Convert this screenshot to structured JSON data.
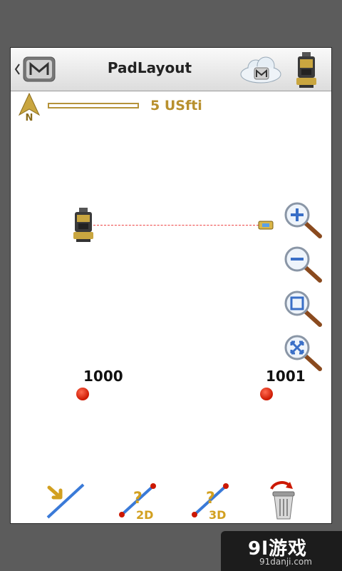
{
  "header": {
    "title": "PadLayout",
    "back_icon": "m-logo-back-icon",
    "cloud_icon": "cloud-sync-icon",
    "device_icon": "total-station-icon"
  },
  "map": {
    "north_label": "N",
    "scale_text": "5 USfti",
    "points": [
      {
        "label": "1000"
      },
      {
        "label": "1001"
      }
    ]
  },
  "zoom_controls": [
    "zoom-in-icon",
    "zoom-out-icon",
    "zoom-extents-icon",
    "zoom-fit-icon"
  ],
  "toolbar": {
    "tool_2d_label": "2D",
    "tool_3d_label": "3D"
  },
  "watermark": {
    "main": "9l游戏",
    "sub": "91danji.com"
  },
  "colors": {
    "accent_gold": "#b8902e",
    "point_red": "#cc1800",
    "line_blue": "#3a7ad8"
  }
}
